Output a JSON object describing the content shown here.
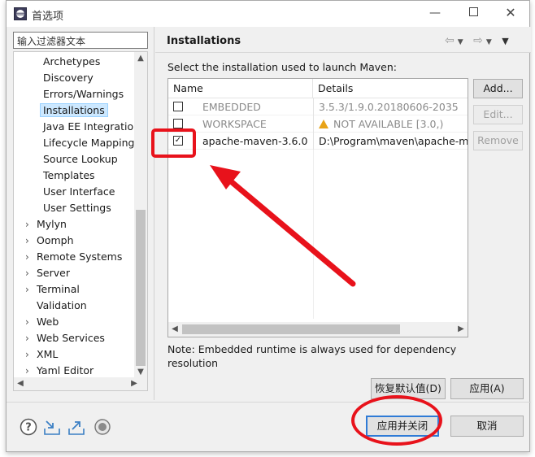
{
  "window": {
    "title": "首选项"
  },
  "filter": {
    "placeholder": "输入过滤器文本"
  },
  "tree": {
    "children": [
      "Archetypes",
      "Discovery",
      "Errors/Warnings",
      "Installations",
      "Java EE Integration",
      "Lifecycle Mappings",
      "Source Lookup",
      "Templates",
      "User Interface",
      "User Settings"
    ],
    "selected": "Installations",
    "parents": [
      "Mylyn",
      "Oomph",
      "Remote Systems",
      "Server",
      "Terminal",
      "Validation",
      "Web",
      "Web Services",
      "XML",
      "Yaml Editor"
    ],
    "parents_no_chevron": [
      "Validation"
    ]
  },
  "page": {
    "title": "Installations",
    "description": "Select the installation used to launch Maven:",
    "columns": {
      "name": "Name",
      "details": "Details"
    },
    "rows": [
      {
        "checked": false,
        "name": "EMBEDDED",
        "details": "3.5.3/1.9.0.20180606-2035",
        "grey": true,
        "warning": false
      },
      {
        "checked": false,
        "name": "WORKSPACE",
        "details": "NOT AVAILABLE [3.0,)",
        "grey": true,
        "warning": true
      },
      {
        "checked": true,
        "name": "apache-maven-3.6.0",
        "details": "D:\\Program\\maven\\apache-mav",
        "grey": false,
        "warning": false
      }
    ],
    "side_buttons": {
      "add": "Add...",
      "edit": "Edit...",
      "remove": "Remove"
    },
    "note": "Note: Embedded runtime is always used for dependency resolution"
  },
  "buttons": {
    "restore_defaults": "恢复默认值(D)",
    "apply": "应用(A)",
    "apply_and_close": "应用并关闭",
    "cancel": "取消"
  },
  "icons": {
    "help": "help-icon",
    "import": "import-icon",
    "export": "export-icon",
    "record": "record-icon",
    "back": "back-arrow-icon",
    "forward": "forward-arrow-icon",
    "menu": "view-menu-icon",
    "warning": "warning-icon"
  },
  "colors": {
    "annotation": "#e8121b",
    "selection": "#cce8ff",
    "default_button_border": "#2f7bd6"
  }
}
